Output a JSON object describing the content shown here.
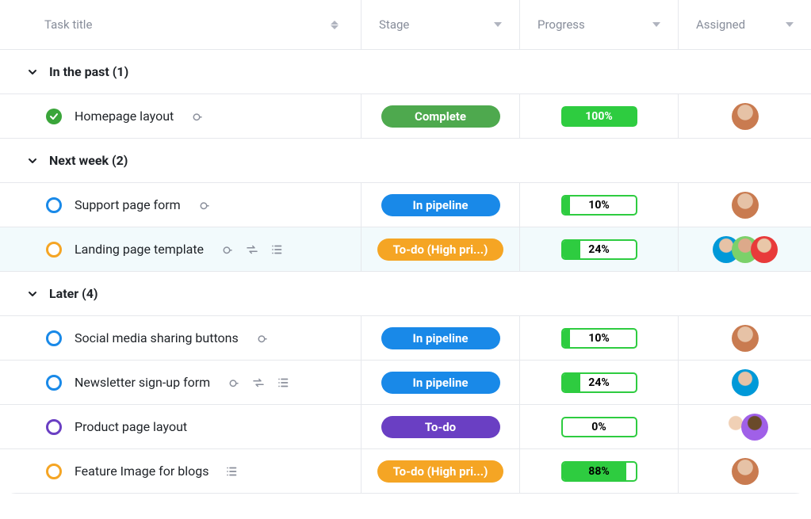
{
  "header": {
    "title": "Task title",
    "stage": "Stage",
    "progress": "Progress",
    "assigned": "Assigned"
  },
  "groups": [
    {
      "label": "In the past (1)",
      "tasks": [
        {
          "title": "Homepage layout",
          "status": "done",
          "attach": true,
          "repeat": false,
          "list": false,
          "stage_label": "Complete",
          "stage_color": "green",
          "progress": 100,
          "assignees": [
            "av-1"
          ],
          "highlight": false
        }
      ]
    },
    {
      "label": "Next week (2)",
      "tasks": [
        {
          "title": "Support page form",
          "status": "blue",
          "attach": true,
          "repeat": false,
          "list": false,
          "stage_label": "In pipeline",
          "stage_color": "blue",
          "progress": 10,
          "assignees": [
            "av-1"
          ],
          "highlight": false
        },
        {
          "title": "Landing page template",
          "status": "orange",
          "attach": true,
          "repeat": true,
          "list": true,
          "stage_label": "To-do (High pri...)",
          "stage_color": "orange",
          "progress": 24,
          "assignees": [
            "av-2",
            "av-4",
            "av-3"
          ],
          "highlight": true
        }
      ]
    },
    {
      "label": "Later (4)",
      "tasks": [
        {
          "title": "Social media sharing buttons",
          "status": "blue",
          "attach": true,
          "repeat": false,
          "list": false,
          "stage_label": "In pipeline",
          "stage_color": "blue",
          "progress": 10,
          "assignees": [
            "av-1"
          ],
          "highlight": false
        },
        {
          "title": "Newsletter sign-up form",
          "status": "blue",
          "attach": true,
          "repeat": true,
          "list": true,
          "stage_label": "In pipeline",
          "stage_color": "blue",
          "progress": 24,
          "assignees": [
            "av-2"
          ],
          "highlight": false
        },
        {
          "title": "Product page layout",
          "status": "purple",
          "attach": false,
          "repeat": false,
          "list": false,
          "stage_label": "To-do",
          "stage_color": "purple",
          "progress": 0,
          "assignees": [
            "av-5",
            "av-6"
          ],
          "highlight": false
        },
        {
          "title": "Feature Image for blogs",
          "status": "orange",
          "attach": false,
          "repeat": false,
          "list": true,
          "stage_label": "To-do (High pri...)",
          "stage_color": "orange",
          "progress": 88,
          "assignees": [
            "av-1"
          ],
          "highlight": false
        }
      ]
    }
  ]
}
